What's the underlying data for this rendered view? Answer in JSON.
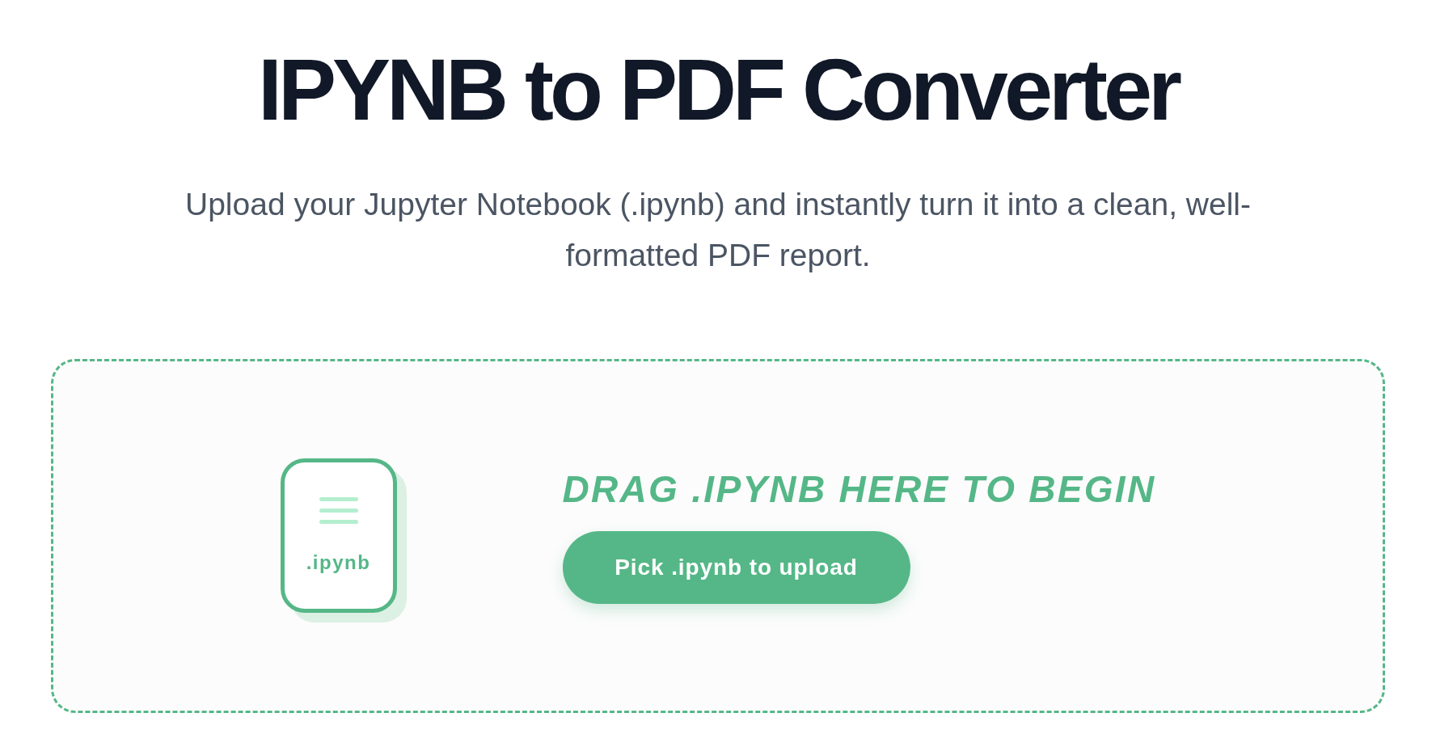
{
  "header": {
    "title": "IPYNB to PDF Converter",
    "subtitle": "Upload your Jupyter Notebook (.ipynb) and instantly turn it into a clean, well-formatted PDF report."
  },
  "dropzone": {
    "file_label": ".ipynb",
    "prompt": "DRAG .IPYNB HERE TO BEGIN",
    "button": "Pick .ipynb to upload"
  }
}
